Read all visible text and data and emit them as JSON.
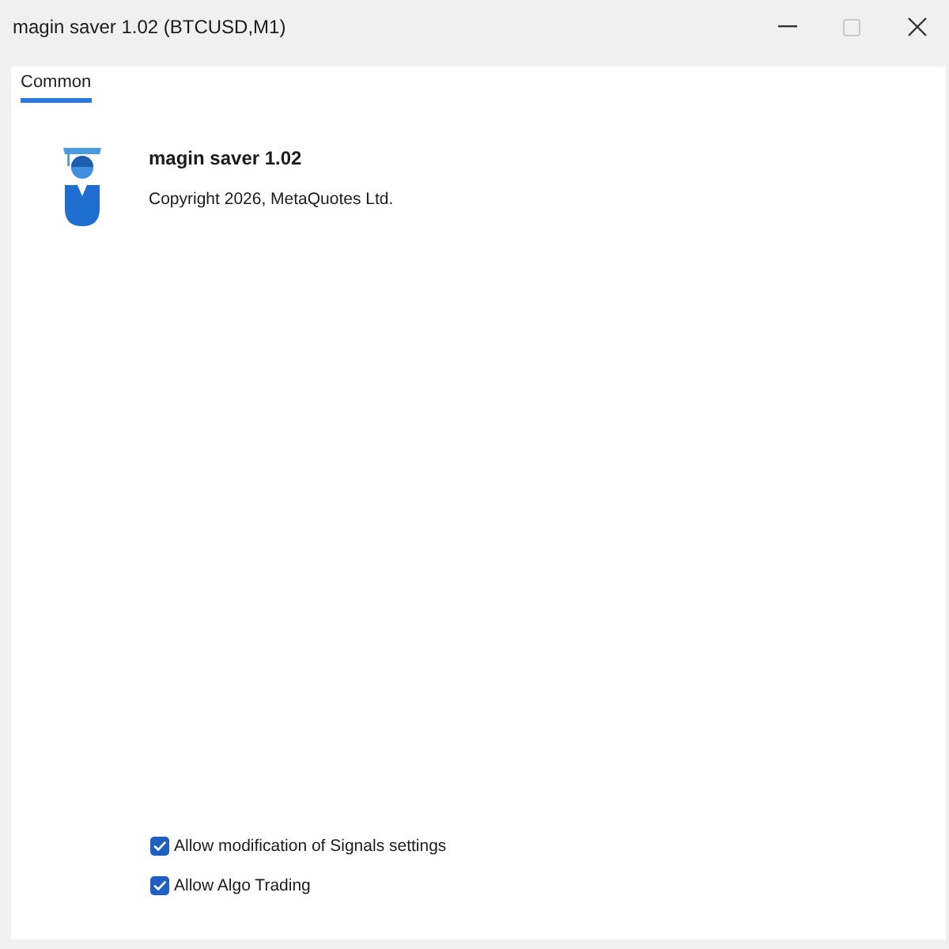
{
  "window": {
    "title": "magin saver 1.02 (BTCUSD,M1)",
    "controls": [
      {
        "kind": "minimize",
        "disabled": false
      },
      {
        "kind": "maximize",
        "disabled": true
      },
      {
        "kind": "close",
        "disabled": false
      }
    ]
  },
  "tabs": [
    {
      "label": "Common",
      "selected": true
    }
  ],
  "program": {
    "name": "magin saver 1.02",
    "copyright": "Copyright 2026, MetaQuotes Ltd."
  },
  "options": [
    {
      "label": "Allow modification of Signals settings",
      "checked": true
    },
    {
      "label": "Allow Algo Trading",
      "checked": true
    }
  ]
}
